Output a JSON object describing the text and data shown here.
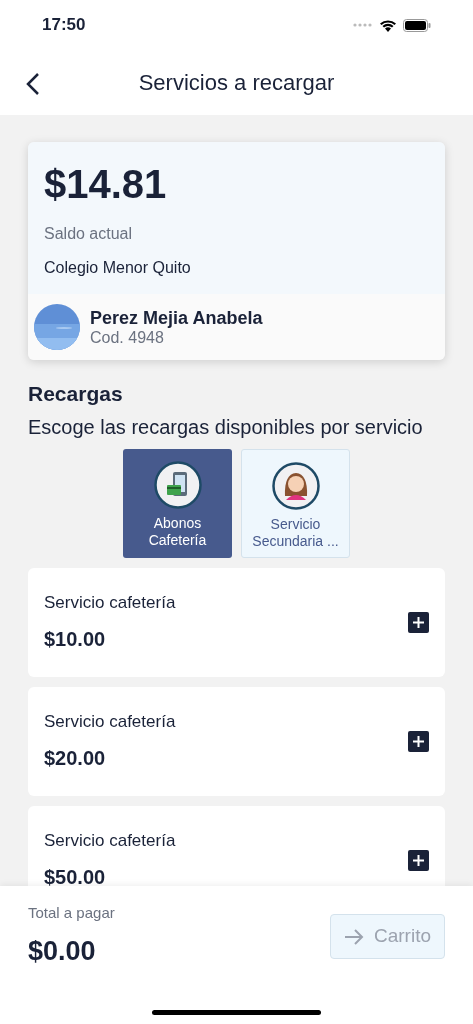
{
  "status_bar": {
    "time": "17:50"
  },
  "header": {
    "title": "Servicios a recargar"
  },
  "balance_card": {
    "amount": "$14.81",
    "label": "Saldo actual",
    "school": "Colegio Menor Quito",
    "student": {
      "name": "Perez Mejia Anabela",
      "code": "Cod. 4948"
    }
  },
  "section": {
    "title": "Recargas",
    "subtitle": "Escoge las recargas disponibles por servicio"
  },
  "services": [
    {
      "kind": "payment",
      "label": "Abonos Cafetería",
      "selected": true
    },
    {
      "kind": "person",
      "label": "Servicio Secundaria ...",
      "selected": false
    }
  ],
  "items": [
    {
      "name": "Servicio cafetería",
      "price": "$10.00"
    },
    {
      "name": "Servicio cafetería",
      "price": "$20.00"
    },
    {
      "name": "Servicio cafetería",
      "price": "$50.00"
    }
  ],
  "footer": {
    "total_label": "Total a pagar",
    "total": "$0.00",
    "button": {
      "label": "Carrito",
      "disabled": true
    }
  }
}
